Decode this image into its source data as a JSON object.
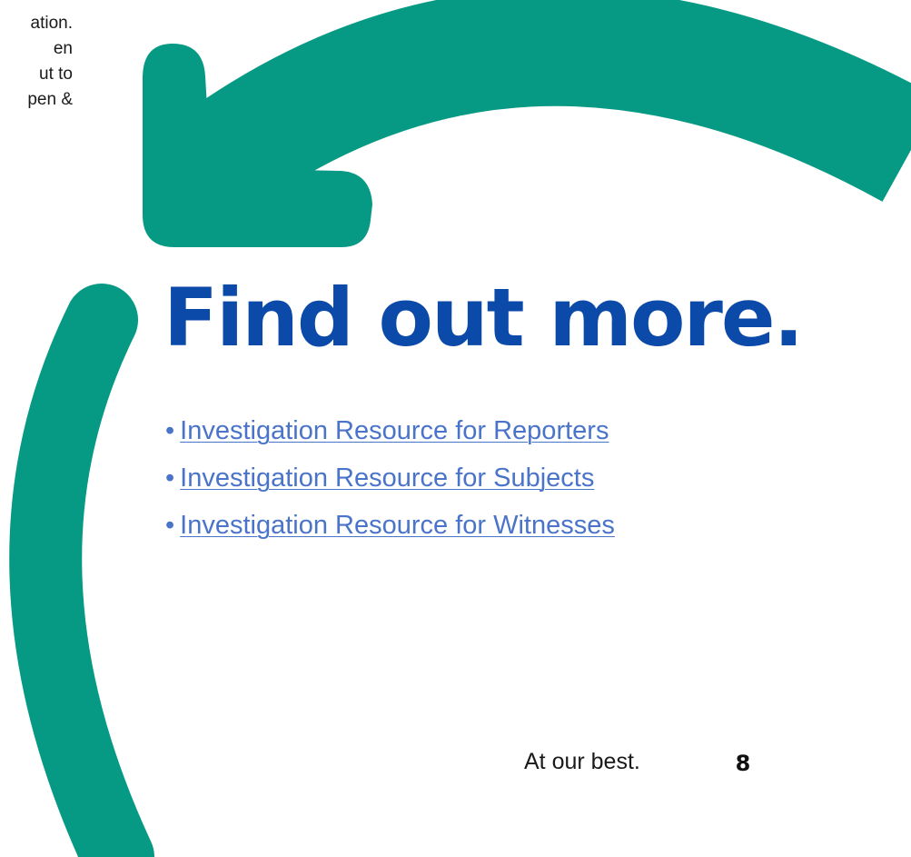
{
  "intro": {
    "lines": [
      "ation.",
      "en",
      "ut to",
      "pen &"
    ]
  },
  "heading": "Find out more.",
  "links": [
    {
      "bullet": "•",
      "label": "Investigation Resource for Reporters"
    },
    {
      "bullet": "•",
      "label": "Investigation Resource for Subjects"
    },
    {
      "bullet": "•",
      "label": "Investigation Resource for Witnesses"
    }
  ],
  "footer": {
    "tagline": "At our best.",
    "page_number": "8"
  },
  "colors": {
    "arrow_green": "#069a84",
    "heading_blue": "#0b4aa8",
    "link_blue": "#4a74c9"
  },
  "icons": {
    "arrow": "circular-arrow-icon"
  }
}
